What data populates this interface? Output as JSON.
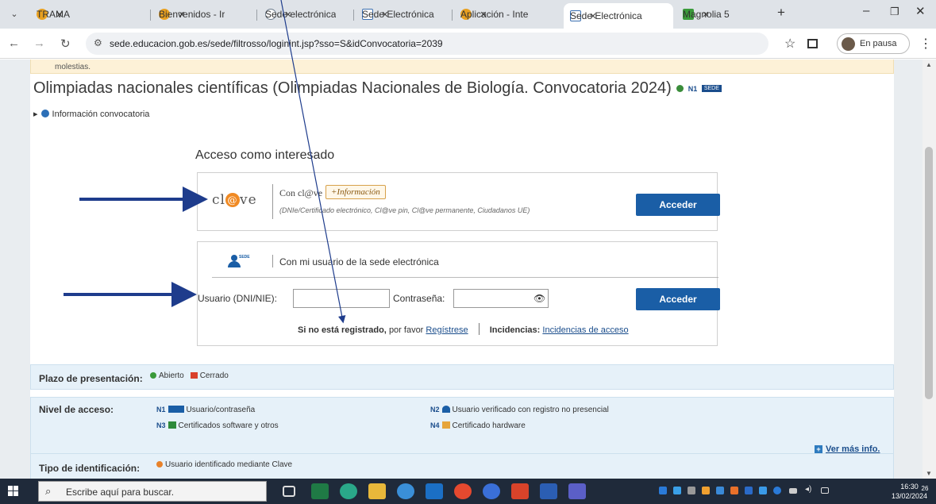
{
  "browser": {
    "tabs": [
      {
        "label": "TRAMA",
        "color": "#e8a020"
      },
      {
        "label": "Bienvenidos - Ir",
        "color": "#e8a020"
      },
      {
        "label": "Sede electrónica",
        "color": "#6b7a8a"
      },
      {
        "label": "Sede Electrónica",
        "color": "#3b6fb0"
      },
      {
        "label": "Aplicación - Inte",
        "color": "#e8a020"
      },
      {
        "label": "Sede Electrónica",
        "color": "#3b6fb0"
      },
      {
        "label": "Magnolia 5",
        "color": "#3a9a3a"
      }
    ],
    "url": "sede.educacion.gob.es/sede/filtrosso/loginint.jsp?sso=S&idConvocatoria=2039",
    "profile_label": "En pausa"
  },
  "page": {
    "notice": "molestias.",
    "title": "Olimpiadas nacionales científicas (Olimpiadas Nacionales de Biología. Convocatoria 2024)",
    "title_level": "N1",
    "sede_tag": "SEDE",
    "info_convocatoria": "Información convocatoria",
    "access_title": "Acceso como interesado",
    "clave": {
      "logo": "cl@ve",
      "label": "Con cl@ve",
      "info_button": "+Información",
      "description": "(DNIe/Certificado electrónico, Cl@ve pin, Cl@ve permanente, Ciudadanos UE)",
      "button": "Acceder"
    },
    "sede_login": {
      "label": "Con mi usuario de la sede electrónica",
      "user_label": "Usuario (DNI/NIE):",
      "password_label": "Contraseña:",
      "button": "Acceder",
      "reg_bold": "Si no está registrado,",
      "reg_text": "por favor",
      "reg_link": "Regístrese",
      "inc_bold": "Incidencias:",
      "inc_link": "Incidencias de acceso"
    },
    "plazo": {
      "label": "Plazo de presentación:",
      "open": "Abierto",
      "closed": "Cerrado"
    },
    "nivel": {
      "label": "Nivel de acceso:",
      "n1": {
        "code": "N1",
        "text": "Usuario/contraseña"
      },
      "n2": {
        "code": "N2",
        "text": "Usuario verificado con registro no presencial"
      },
      "n3": {
        "code": "N3",
        "text": "Certificados software y otros"
      },
      "n4": {
        "code": "N4",
        "text": "Certificado hardware"
      },
      "more": "Ver más info."
    },
    "tipo": {
      "label": "Tipo de identificación:",
      "value": "Usuario identificado mediante Clave"
    }
  },
  "taskbar": {
    "search_placeholder": "Escribe aquí para buscar.",
    "time": "16:30",
    "date": "13/02/2024",
    "notifications": "26"
  }
}
